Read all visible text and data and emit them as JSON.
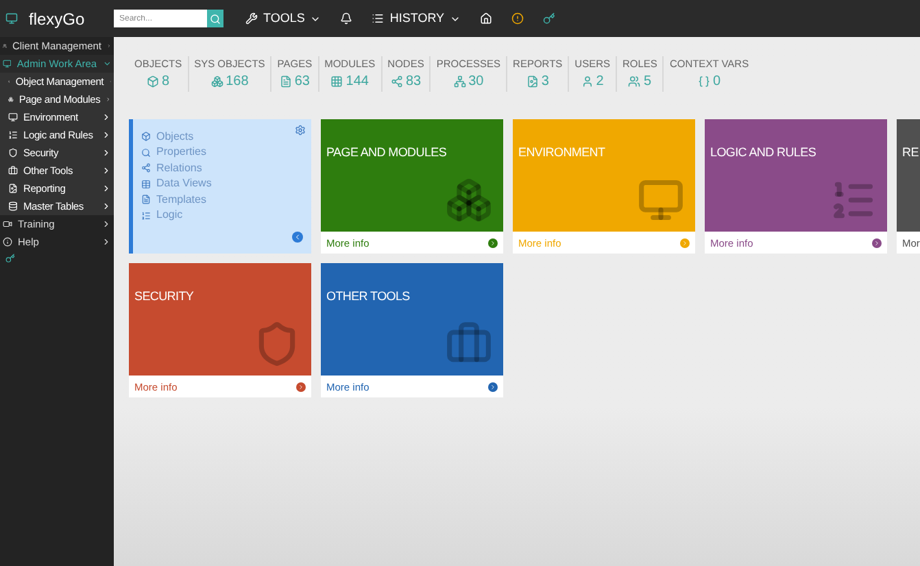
{
  "app": {
    "title": "flexyGo"
  },
  "search": {
    "placeholder": "Search..."
  },
  "topnav": [
    {
      "kind": "tools",
      "label": "TOOLS",
      "dropdown": true
    },
    {
      "kind": "bell"
    },
    {
      "kind": "history",
      "label": "HISTORY",
      "dropdown": true
    },
    {
      "kind": "home"
    },
    {
      "kind": "alert"
    },
    {
      "kind": "key"
    }
  ],
  "sidebar": {
    "items": [
      {
        "label": "Client Management",
        "expanded": false,
        "selected": false
      },
      {
        "label": "Admin Work Area",
        "expanded": true,
        "selected": true,
        "children": [
          {
            "label": "Object Management"
          },
          {
            "label": "Page and Modules"
          },
          {
            "label": "Environment"
          },
          {
            "label": "Logic and Rules"
          },
          {
            "label": "Security"
          },
          {
            "label": "Other Tools"
          },
          {
            "label": "Reporting"
          },
          {
            "label": "Master Tables"
          }
        ]
      },
      {
        "label": "Training",
        "expanded": false,
        "selected": false
      },
      {
        "label": "Help",
        "expanded": false,
        "selected": false
      }
    ]
  },
  "stats": [
    {
      "label": "OBJECTS",
      "value": "8"
    },
    {
      "label": "SYS OBJECTS",
      "value": "168"
    },
    {
      "label": "PAGES",
      "value": "63"
    },
    {
      "label": "MODULES",
      "value": "144"
    },
    {
      "label": "NODES",
      "value": "83"
    },
    {
      "label": "PROCESSES",
      "value": "30"
    },
    {
      "label": "REPORTS",
      "value": "3"
    },
    {
      "label": "USERS",
      "value": "2"
    },
    {
      "label": "ROLES",
      "value": "5"
    },
    {
      "label": "CONTEXT VARS",
      "value": "0"
    }
  ],
  "tiles": [
    {
      "kind": "list",
      "items": [
        {
          "label": "Objects"
        },
        {
          "label": "Properties"
        },
        {
          "label": "Relations"
        },
        {
          "label": "Data Views"
        },
        {
          "label": "Templates"
        },
        {
          "label": "Logic"
        }
      ]
    },
    {
      "kind": "card",
      "title": "PAGE AND MODULES",
      "color": "#2e7d0e",
      "link": "More info"
    },
    {
      "kind": "card",
      "title": "ENVIRONMENT",
      "color": "#f0a800",
      "link": "More info"
    },
    {
      "kind": "card",
      "title": "LOGIC AND RULES",
      "color": "#8a4b89",
      "link": "More info"
    },
    {
      "kind": "card",
      "title": "RE",
      "color": "#505050",
      "link": "Mor"
    },
    {
      "kind": "card",
      "title": "SECURITY",
      "color": "#c64b2f",
      "link": "More info"
    },
    {
      "kind": "card",
      "title": "OTHER TOOLS",
      "color": "#2265b1",
      "link": "More info"
    }
  ]
}
